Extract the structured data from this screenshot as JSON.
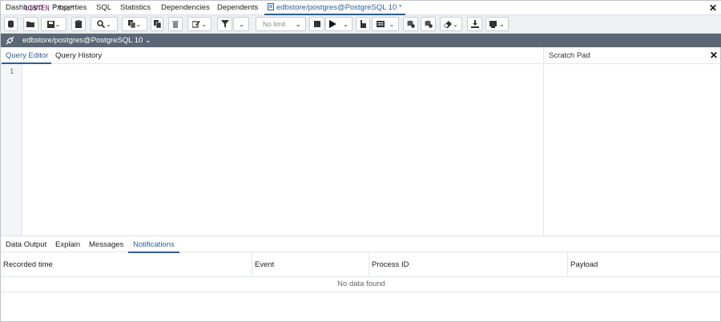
{
  "tabs": [
    {
      "label": "Dashboard"
    },
    {
      "label": "Properties"
    },
    {
      "label": "SQL"
    },
    {
      "label": "Statistics"
    },
    {
      "label": "Dependencies"
    },
    {
      "label": "Dependents"
    },
    {
      "label": "edbstore/postgres@PostgreSQL 10 *"
    }
  ],
  "close_symbol": "✕",
  "toolbar": {
    "limit_select": "No limit",
    "icons": [
      "database-icon",
      "folder-open-icon",
      "save-icon",
      "save-dropdown",
      "clipboard-icon",
      "search-icon",
      "search-dropdown",
      "copy-icon",
      "copy-dropdown",
      "paste-icon",
      "trash-icon",
      "edit-icon",
      "edit-dropdown",
      "filter-icon",
      "filter-dropdown",
      "stop-icon",
      "play-icon",
      "play-dropdown",
      "hand-icon",
      "explain-icon",
      "explain-dropdown",
      "commit-icon",
      "rollback-icon",
      "eraser-icon",
      "download-icon",
      "macro-icon"
    ]
  },
  "connection": {
    "label": "edbstore/postgres@PostgreSQL 10 ⌄"
  },
  "editor": {
    "tabs": [
      {
        "label": "Query Editor"
      },
      {
        "label": "Query History"
      }
    ],
    "line_number": "1",
    "code_keyword": "LISTEN",
    "code_string": "\"foo\""
  },
  "scratch_pad": {
    "title": "Scratch Pad"
  },
  "output": {
    "tabs": [
      {
        "label": "Data Output"
      },
      {
        "label": "Explain"
      },
      {
        "label": "Messages"
      },
      {
        "label": "Notifications"
      }
    ],
    "columns": [
      {
        "label": "Recorded time"
      },
      {
        "label": "Event"
      },
      {
        "label": "Process ID"
      },
      {
        "label": "Payload"
      }
    ],
    "empty_message": "No data found"
  },
  "colors": {
    "accent": "#2c5e9a",
    "connection_bar": "#5a6776",
    "keyword": "#8a1f78"
  }
}
